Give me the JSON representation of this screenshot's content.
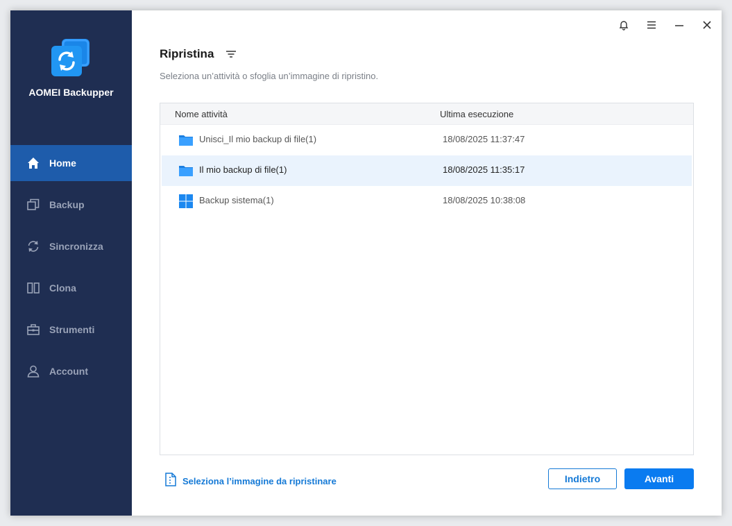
{
  "app": {
    "name": "AOMEI Backupper"
  },
  "sidebar": {
    "items": [
      {
        "label": "Home",
        "icon": "home-icon",
        "active": true
      },
      {
        "label": "Backup",
        "icon": "backup-icon",
        "active": false
      },
      {
        "label": "Sincronizza",
        "icon": "sync-icon",
        "active": false
      },
      {
        "label": "Clona",
        "icon": "clone-icon",
        "active": false
      },
      {
        "label": "Strumenti",
        "icon": "tools-icon",
        "active": false
      },
      {
        "label": "Account",
        "icon": "account-icon",
        "active": false
      }
    ]
  },
  "titlebar": {
    "icons": [
      "bell-icon",
      "menu-icon",
      "minimize-icon",
      "close-icon"
    ]
  },
  "main": {
    "title": "Ripristina",
    "subtitle": "Seleziona un’attività o sfoglia un’immagine di ripristino.",
    "table": {
      "headers": {
        "name": "Nome attività",
        "last_run": "Ultima esecuzione"
      },
      "rows": [
        {
          "name": "Unisci_Il mio backup di file(1)",
          "last_run": "18/08/2025 11:37:47",
          "icon": "folder-icon",
          "selected": false
        },
        {
          "name": "Il mio backup di file(1)",
          "last_run": "18/08/2025 11:35:17",
          "icon": "folder-icon",
          "selected": true
        },
        {
          "name": "Backup sistema(1)",
          "last_run": "18/08/2025 10:38:08",
          "icon": "windows-icon",
          "selected": false
        }
      ]
    },
    "select_image_label": "Seleziona l’immagine da ripristinare",
    "back_label": "Indietro",
    "next_label": "Avanti"
  },
  "colors": {
    "sidebar_bg": "#1f2e52",
    "active_nav": "#1e5cab",
    "accent": "#0a7bf0",
    "link": "#1479d6",
    "selected_row": "#eaf3fd"
  }
}
